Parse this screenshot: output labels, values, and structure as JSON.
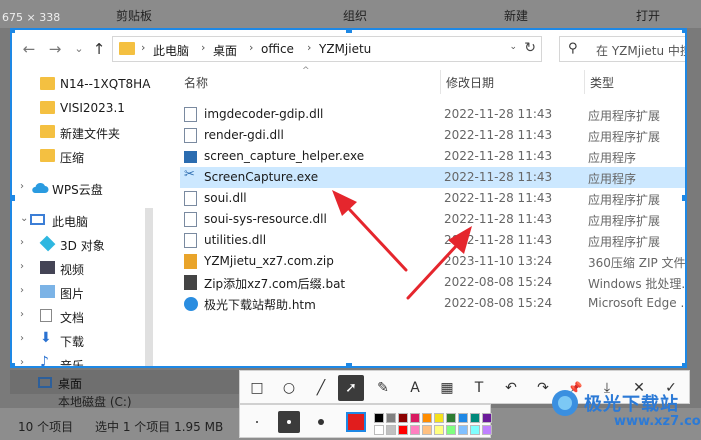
{
  "background": {
    "size_readout": "675 × 338",
    "ribbon_groups": [
      "剪贴板",
      "组织",
      "新建",
      "打开"
    ],
    "status": {
      "items": "10 个项目",
      "selected": "选中 1 个项目 1.95 MB"
    }
  },
  "nav": {
    "back": "←",
    "forward": "→",
    "recent": "⌄",
    "up": "↑",
    "breadcrumbs": [
      "此电脑",
      "桌面",
      "office",
      "YZMjietu"
    ],
    "search_placeholder": "在 YZMjietu 中搜索"
  },
  "sidebar": {
    "items": [
      {
        "label": "N14--1XQT8HA",
        "icon": "folder-icon"
      },
      {
        "label": "VISI2023.1",
        "icon": "folder-icon"
      },
      {
        "label": "新建文件夹",
        "icon": "folder-icon"
      },
      {
        "label": "压缩",
        "icon": "folder-icon"
      },
      {
        "label": "WPS云盘",
        "icon": "cloud-icon"
      },
      {
        "label": "此电脑",
        "icon": "computer-icon"
      },
      {
        "label": "3D 对象",
        "icon": "cube-icon"
      },
      {
        "label": "视频",
        "icon": "video-icon"
      },
      {
        "label": "图片",
        "icon": "picture-icon"
      },
      {
        "label": "文档",
        "icon": "document-icon"
      },
      {
        "label": "下载",
        "icon": "download-icon"
      },
      {
        "label": "音乐",
        "icon": "music-icon"
      },
      {
        "label": "桌面",
        "icon": "desktop-icon"
      },
      {
        "label": "本地磁盘 (C:)",
        "icon": "drive-icon"
      }
    ]
  },
  "columns": {
    "name": "名称",
    "date": "修改日期",
    "type": "类型"
  },
  "files": [
    {
      "name": "imgdecoder-gdip.dll",
      "date": "2022-11-28 11:43",
      "type": "应用程序扩展",
      "kind": "dll"
    },
    {
      "name": "render-gdi.dll",
      "date": "2022-11-28 11:43",
      "type": "应用程序扩展",
      "kind": "dll"
    },
    {
      "name": "screen_capture_helper.exe",
      "date": "2022-11-28 11:43",
      "type": "应用程序",
      "kind": "exe"
    },
    {
      "name": "ScreenCapture.exe",
      "date": "2022-11-28 11:43",
      "type": "应用程序",
      "kind": "scissors"
    },
    {
      "name": "soui.dll",
      "date": "2022-11-28 11:43",
      "type": "应用程序扩展",
      "kind": "dll"
    },
    {
      "name": "soui-sys-resource.dll",
      "date": "2022-11-28 11:43",
      "type": "应用程序扩展",
      "kind": "dll"
    },
    {
      "name": "utilities.dll",
      "date": "2022-11-28 11:43",
      "type": "应用程序扩展",
      "kind": "dll"
    },
    {
      "name": "YZMjietu_xz7.com.zip",
      "date": "2023-11-10 13:24",
      "type": "360压缩 ZIP 文件",
      "kind": "zip"
    },
    {
      "name": "Zip添加xz7.com后缀.bat",
      "date": "2022-08-08 15:24",
      "type": "Windows 批处理...",
      "kind": "bat"
    },
    {
      "name": "极光下载站帮助.htm",
      "date": "2022-08-08 15:24",
      "type": "Microsoft Edge ...",
      "kind": "htm"
    }
  ],
  "toolbar": {
    "tools": [
      "□",
      "○",
      "╱",
      "➚",
      "✎",
      "A",
      "▦",
      "T",
      "↶",
      "↷",
      "📌",
      "⤓",
      "✕",
      "✓"
    ],
    "tool_icons": [
      "rectangle-tool-icon",
      "ellipse-tool-icon",
      "line-tool-icon",
      "arrow-tool-icon",
      "pen-tool-icon",
      "marker-tool-icon",
      "mosaic-tool-icon",
      "text-tool-icon",
      "undo-icon",
      "redo-icon",
      "pin-icon",
      "save-icon",
      "cancel-icon",
      "confirm-icon"
    ],
    "active_tool": 3
  },
  "palette": {
    "current_color": "#e11d1d",
    "swatches_top": [
      "#000000",
      "#808080",
      "#8b0000",
      "#d81b60",
      "#ff8c00",
      "#f5e11b",
      "#2e7d32",
      "#1e88e5",
      "#00897b",
      "#6a1b9a"
    ],
    "swatches_bottom": [
      "#ffffff",
      "#c0c0c0",
      "#ff0000",
      "#ff80c0",
      "#ffc080",
      "#ffff80",
      "#80ff80",
      "#80c0ff",
      "#80ffff",
      "#c080ff"
    ]
  },
  "watermark": {
    "title": "极光下载站",
    "url": "www.xz7.com"
  },
  "colors": {
    "selection_border": "#1e88e5",
    "arrow": "#e5262d",
    "selected_row": "#cce8ff"
  }
}
